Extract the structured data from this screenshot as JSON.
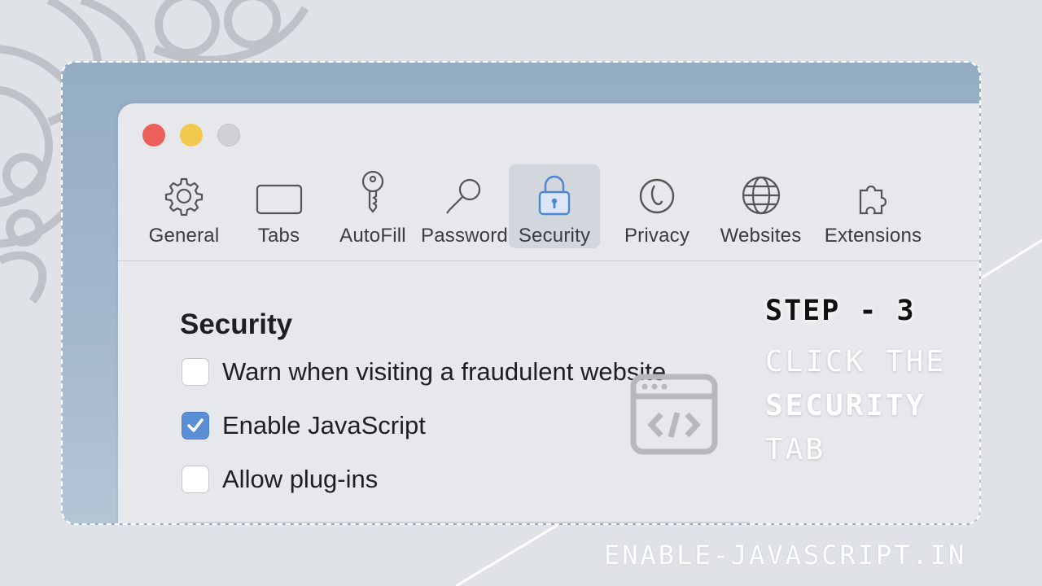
{
  "preferences_window": {
    "tabs": [
      {
        "label": "General",
        "icon": "gear-icon"
      },
      {
        "label": "Tabs",
        "icon": "tab-window-icon"
      },
      {
        "label": "AutoFill",
        "icon": "autofill-pen-icon"
      },
      {
        "label": "Passwords",
        "icon": "key-icon"
      },
      {
        "label": "Security",
        "icon": "lock-icon",
        "active": true
      },
      {
        "label": "Privacy",
        "icon": "hand-icon"
      },
      {
        "label": "Websites",
        "icon": "globe-icon"
      },
      {
        "label": "Extensions",
        "icon": "puzzle-icon"
      }
    ],
    "section_title": "Security",
    "options": [
      {
        "label": "Warn when visiting a fraudulent website",
        "checked": false
      },
      {
        "label": "Enable JavaScript",
        "checked": true
      },
      {
        "label": "Allow plug-ins",
        "checked": false
      }
    ]
  },
  "step": {
    "title": "STEP - 3",
    "line1": "CLICK THE",
    "line2": "SECURITY",
    "line3": "TAB"
  },
  "footer": {
    "site": "ENABLE-JAVASCRIPT.IN"
  },
  "colors": {
    "close": "#ec5f5a",
    "minimize": "#f2c94c",
    "zoom": "#cfd1d5",
    "accent": "#5a8fd6",
    "frame_bg": "#94adc5"
  }
}
